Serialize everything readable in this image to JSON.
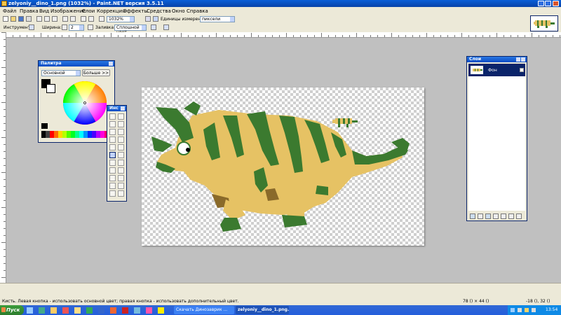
{
  "window": {
    "title": "zelyoniy__dino_1.png (1032%) - Paint.NET версия 3.5.11"
  },
  "menu": [
    "Файл",
    "Правка",
    "Вид",
    "Изображение",
    "Слои",
    "Коррекция",
    "Эффекты",
    "Средства",
    "Окно",
    "Справка"
  ],
  "toolbar1": {
    "zoom_value": "1032%",
    "units_label": "Единицы измерения:",
    "units_value": "пиксели"
  },
  "toolbar2": {
    "tool_label": "Инструмент:",
    "width_label": "Ширина:",
    "width_value": "2",
    "fill_label": "Заливка:",
    "fill_value": "Сплошной цвет"
  },
  "palette": {
    "title": "Палитра",
    "mode_value": "Основной",
    "more_button": "Больше >>",
    "swatches": [
      "#000000",
      "#404040",
      "#ff0000",
      "#ff6a00",
      "#ffd800",
      "#b6ff00",
      "#4cff00",
      "#00ff21",
      "#00ff90",
      "#00ffff",
      "#0094ff",
      "#0026ff",
      "#4800ff",
      "#b200ff",
      "#ff00dc",
      "#ff006e"
    ]
  },
  "tools": {
    "title": "Инс"
  },
  "layers": {
    "title": "Слои",
    "layer_name": "Фон"
  },
  "status": {
    "hint": "Кисть. Левая кнопка - использовать основной цвет; правая кнопка - использовать дополнительный цвет.",
    "size": "78 () × 44 ()",
    "coords": "-18 (), 32 ()"
  },
  "taskbar": {
    "start": "Пуск",
    "tasks": [
      "Скачать Динозаврик ...",
      "zelyoniy__dino_1.png..."
    ],
    "clock": "13:54"
  },
  "colors": {
    "dino_dark": "#3b7a2f",
    "dino_light": "#e6c264",
    "dino_mid": "#c8a143",
    "dino_foot": "#8a6a2a"
  }
}
